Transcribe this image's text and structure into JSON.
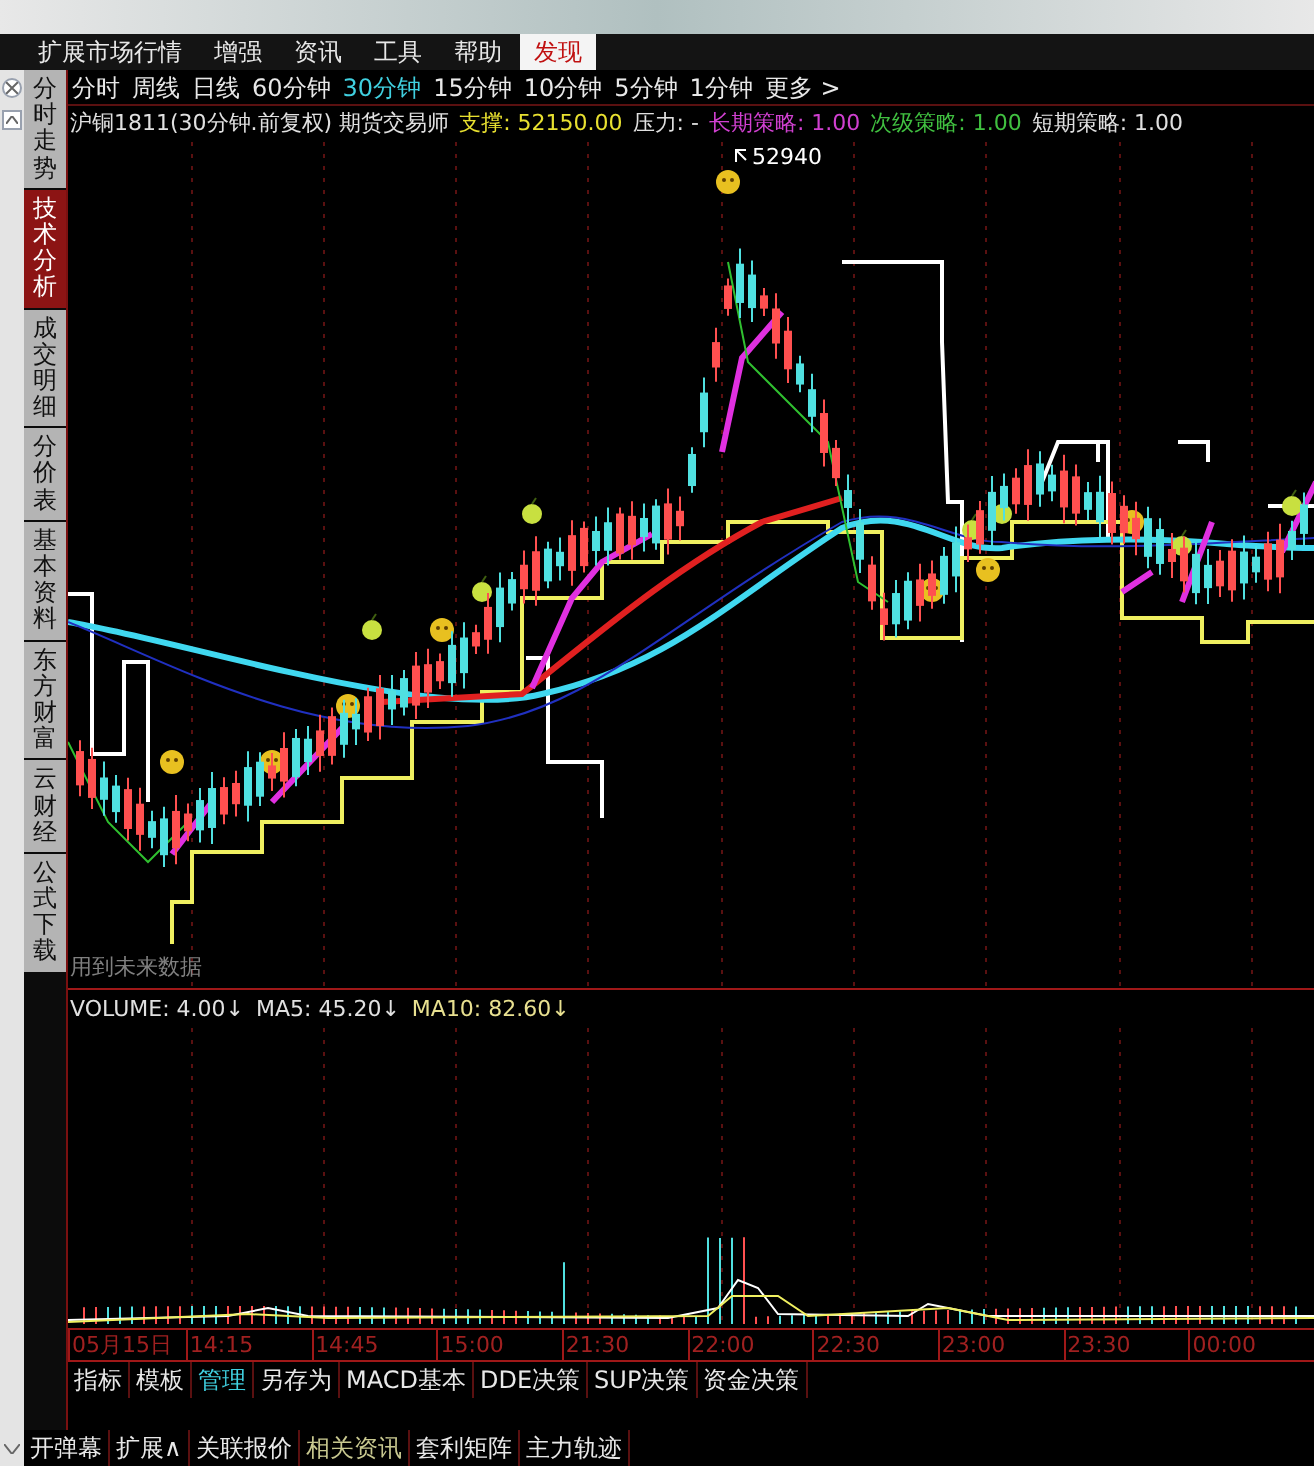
{
  "menu": [
    {
      "label": "扩展市场行情",
      "selected": false
    },
    {
      "label": "增强",
      "selected": false
    },
    {
      "label": "资讯",
      "selected": false
    },
    {
      "label": "工具",
      "selected": false
    },
    {
      "label": "帮助",
      "selected": false
    },
    {
      "label": "发现",
      "selected": true
    }
  ],
  "side_tabs": [
    {
      "label": "分时走势",
      "selected": false
    },
    {
      "label": "技术分析",
      "selected": true
    },
    {
      "label": "成交明细",
      "selected": false
    },
    {
      "label": "分价表",
      "selected": false
    },
    {
      "label": "基本资料",
      "selected": false
    },
    {
      "label": "东方财富",
      "selected": false
    },
    {
      "label": "云财经",
      "selected": false
    },
    {
      "label": "公式下载",
      "selected": false
    }
  ],
  "periods": [
    {
      "label": "分时",
      "selected": false
    },
    {
      "label": "周线",
      "selected": false
    },
    {
      "label": "日线",
      "selected": false
    },
    {
      "label": "60分钟",
      "selected": false
    },
    {
      "label": "30分钟",
      "selected": true
    },
    {
      "label": "15分钟",
      "selected": false
    },
    {
      "label": "10分钟",
      "selected": false
    },
    {
      "label": "5分钟",
      "selected": false
    },
    {
      "label": "1分钟",
      "selected": false
    },
    {
      "label": "更多 >",
      "selected": false
    }
  ],
  "info": [
    {
      "text": "沪铜1811(30分钟.前复权) 期货交易师",
      "color": "#e0e0e0"
    },
    {
      "text": "支撑: 52150.00",
      "color": "#e8e030"
    },
    {
      "text": "压力: -",
      "color": "#e0e0e0"
    },
    {
      "text": "长期策略: 1.00",
      "color": "#d040d0"
    },
    {
      "text": "次级策略: 1.00",
      "color": "#40c040"
    },
    {
      "text": "短期策略: 1.00",
      "color": "#e0e0e0"
    }
  ],
  "chart": {
    "peak_label": "52940",
    "note": "用到未来数据"
  },
  "volume": [
    {
      "text": "VOLUME: 4.00↓",
      "color": "#e0e0e0"
    },
    {
      "text": "MA5: 45.20↓",
      "color": "#e0e0e0"
    },
    {
      "text": "MA10: 82.60↓",
      "color": "#e8e090"
    }
  ],
  "time_axis": [
    "05月15日",
    "14:15",
    "14:45",
    "15:00",
    "21:30",
    "22:00",
    "22:30",
    "23:00",
    "23:30",
    "00:00"
  ],
  "indicator_tabs": [
    {
      "label": "指标",
      "selected": false
    },
    {
      "label": "模板",
      "selected": false
    },
    {
      "label": "管理",
      "selected": true
    },
    {
      "label": "另存为",
      "selected": false
    },
    {
      "label": "MACD基本",
      "selected": false
    },
    {
      "label": "DDE决策",
      "selected": false
    },
    {
      "label": "SUP决策",
      "selected": false
    },
    {
      "label": "资金决策",
      "selected": false
    }
  ],
  "bottom_tabs": [
    {
      "label": "开弹幕",
      "selected": false
    },
    {
      "label": "扩展∧",
      "selected": false
    },
    {
      "label": "关联报价",
      "selected": false
    },
    {
      "label": "相关资讯",
      "selected": true
    },
    {
      "label": "套利矩阵",
      "selected": false
    },
    {
      "label": "主力轨迹",
      "selected": false
    }
  ]
}
